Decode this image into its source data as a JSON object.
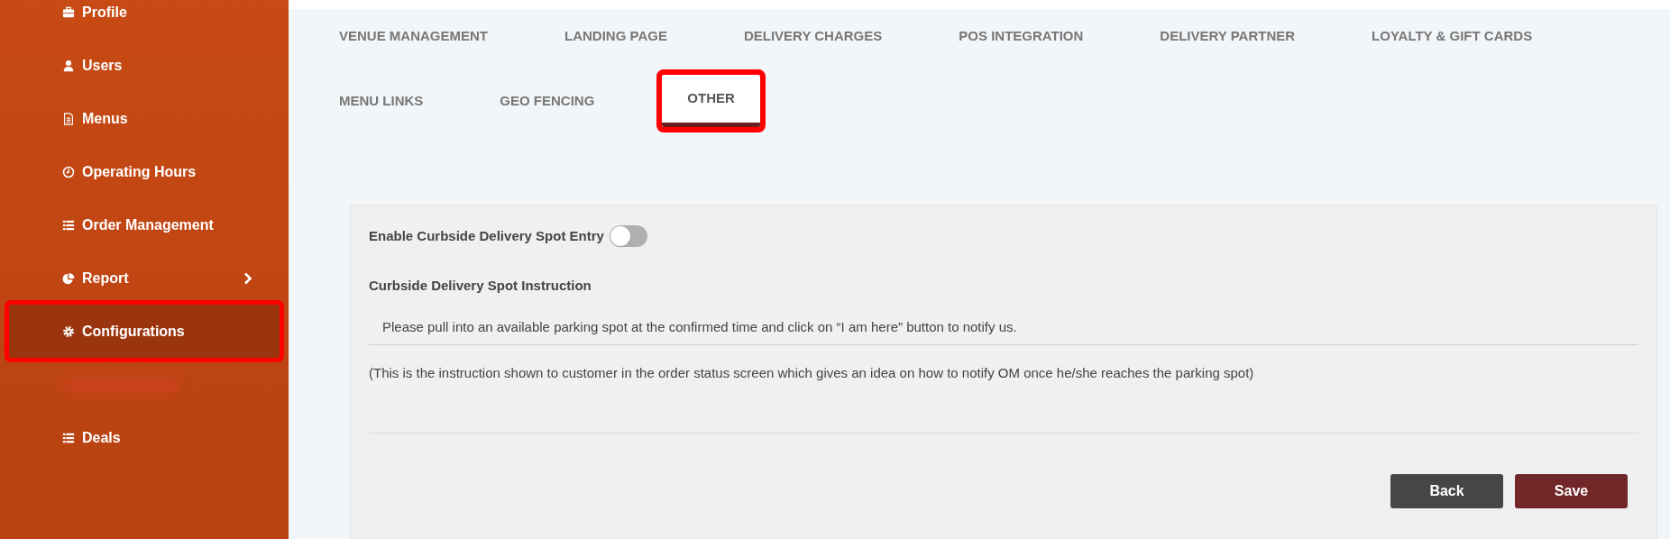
{
  "sidebar": {
    "items": [
      {
        "label": "Profile",
        "kind": "briefcase",
        "selected": false
      },
      {
        "label": "Users",
        "kind": "user",
        "selected": false
      },
      {
        "label": "Menus",
        "kind": "file",
        "selected": false
      },
      {
        "label": "Operating Hours",
        "kind": "clock",
        "selected": false
      },
      {
        "label": "Order Management",
        "kind": "list",
        "selected": false
      },
      {
        "label": "Report",
        "kind": "pie",
        "selected": false,
        "has_submenu": true
      },
      {
        "label": "Configurations",
        "kind": "gear",
        "selected": true
      },
      {
        "kind": "blurred"
      },
      {
        "label": "Deals",
        "kind": "list",
        "selected": false
      }
    ]
  },
  "tabs": [
    [
      {
        "label": "VENUE MANAGEMENT",
        "selected": false
      },
      {
        "label": "LANDING PAGE",
        "selected": false
      },
      {
        "label": "DELIVERY CHARGES",
        "selected": false
      },
      {
        "label": "POS INTEGRATION",
        "selected": false
      },
      {
        "label": "DELIVERY PARTNER",
        "selected": false
      },
      {
        "label": "LOYALTY & GIFT CARDS",
        "selected": false
      }
    ],
    [
      {
        "label": "MENU LINKS",
        "selected": false
      },
      {
        "label": "GEO FENCING",
        "selected": false
      },
      {
        "label": "OTHER",
        "selected": true
      }
    ]
  ],
  "form": {
    "toggle": {
      "label": "Enable Curbside Delivery Spot Entry",
      "on": false
    },
    "instruction": {
      "label": "Curbside Delivery Spot Instruction",
      "value": "Please pull into an available parking spot at the confirmed time and click on “I am here” button to notify us.",
      "help": "(This is the instruction shown to customer in the order status screen which gives an idea on how to notify OM once he/she reaches the parking spot)"
    },
    "buttons": [
      {
        "label": "Back",
        "kind": "secondary"
      },
      {
        "label": "Save",
        "kind": "primary"
      }
    ]
  }
}
